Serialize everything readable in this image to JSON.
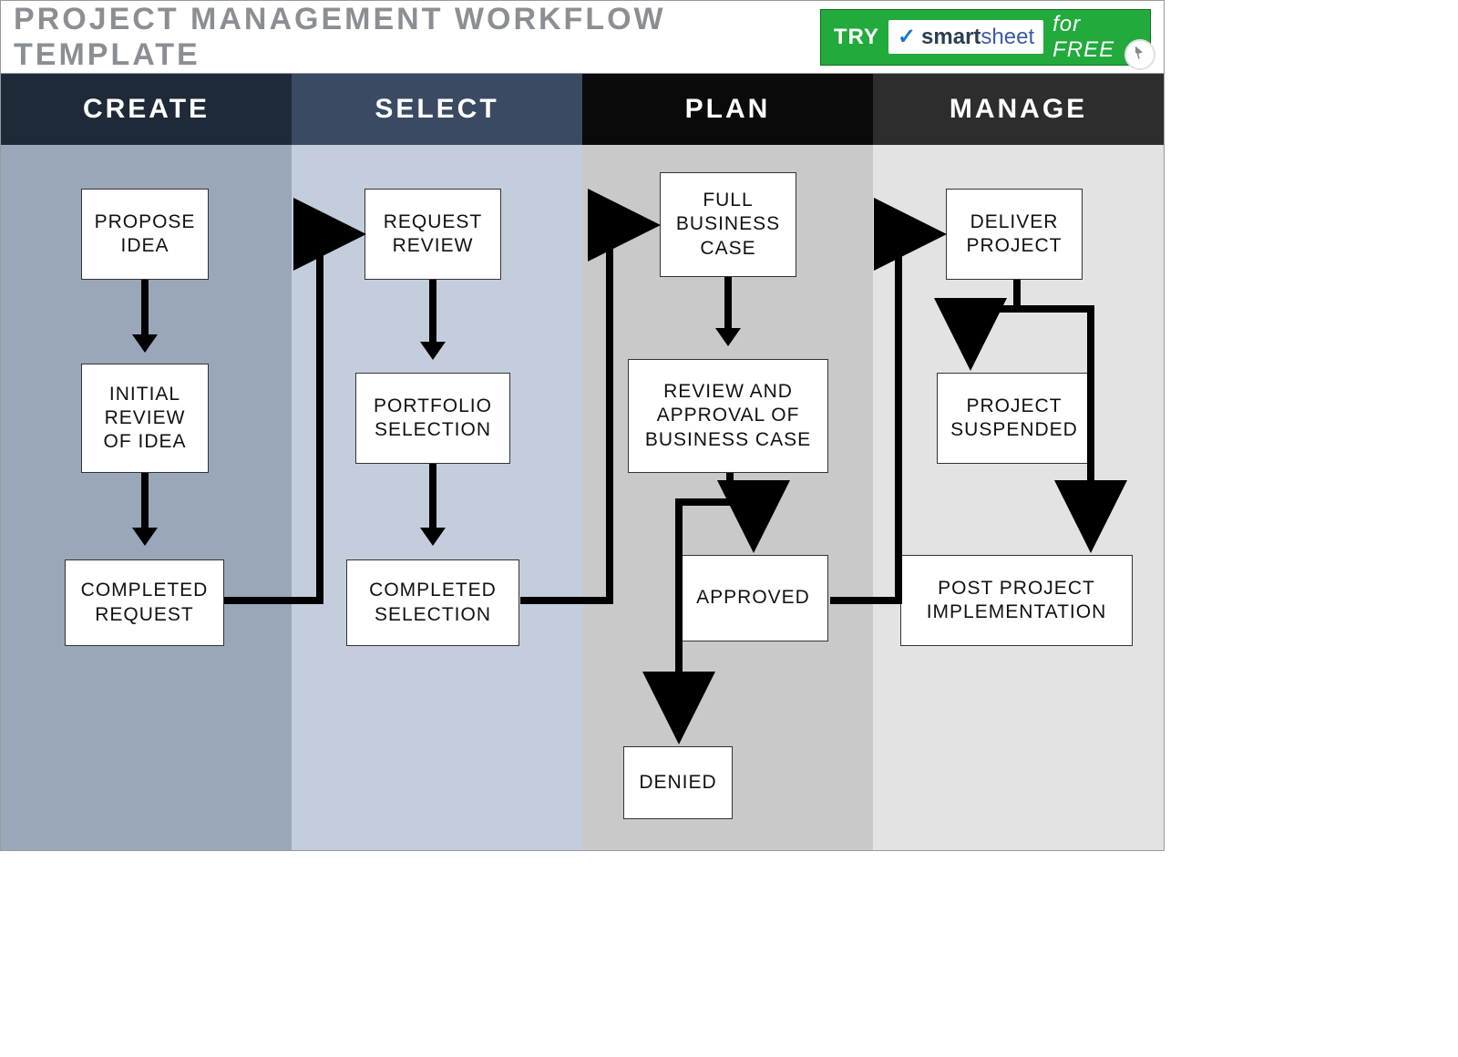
{
  "title": "PROJECT MANAGEMENT WORKFLOW TEMPLATE",
  "cta": {
    "try": "TRY",
    "brand_bold": "smart",
    "brand_light": "sheet",
    "forfree": "for FREE"
  },
  "columns": {
    "c1": {
      "header": "CREATE"
    },
    "c2": {
      "header": "SELECT"
    },
    "c3": {
      "header": "PLAN"
    },
    "c4": {
      "header": "MANAGE"
    }
  },
  "boxes": {
    "propose_idea": "PROPOSE IDEA",
    "initial_review": "INITIAL REVIEW OF IDEA",
    "completed_request": "COMPLETED REQUEST",
    "request_review": "REQUEST REVIEW",
    "portfolio_selection": "PORTFOLIO SELECTION",
    "completed_selection": "COMPLETED SELECTION",
    "full_business_case": "FULL BUSINESS CASE",
    "review_approval": "REVIEW AND APPROVAL OF BUSINESS CASE",
    "approved": "APPROVED",
    "denied": "DENIED",
    "deliver_project": "DELIVER PROJECT",
    "project_suspended": "PROJECT SUSPENDED",
    "post_project": "POST PROJECT IMPLEMENTATION"
  }
}
